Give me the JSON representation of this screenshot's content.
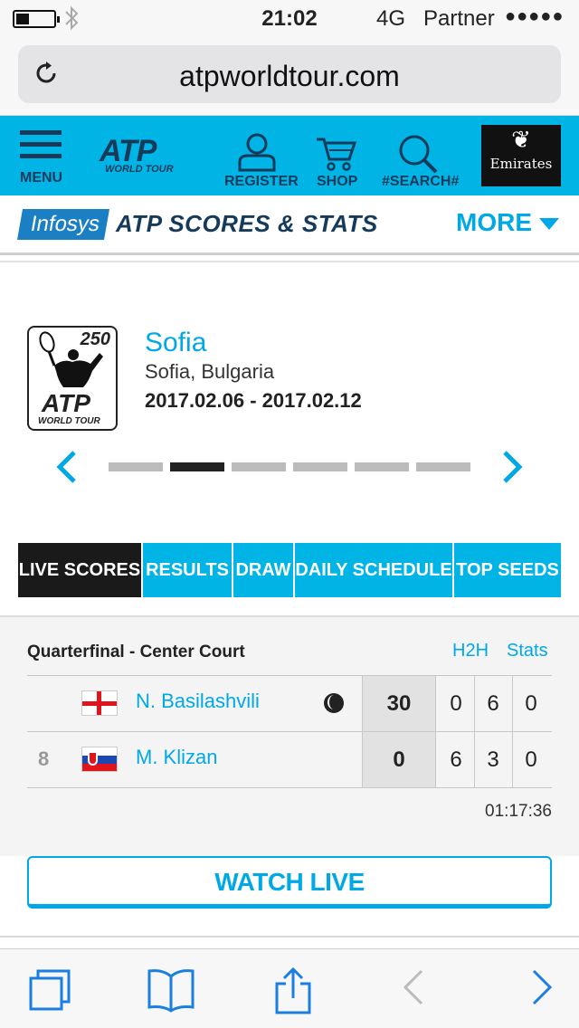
{
  "status_bar": {
    "time": "21:02",
    "network": "4G",
    "carrier": "Partner",
    "signal": "●●●●●"
  },
  "browser": {
    "url": "atpworldtour.com"
  },
  "header": {
    "menu_label": "MENU",
    "logo_main": "ATP",
    "logo_sub": "WORLD TOUR",
    "register_label": "REGISTER",
    "shop_label": "SHOP",
    "search_label": "#SEARCH#",
    "sponsor_label": "Emirates",
    "brand_color": "#00b4e6"
  },
  "scores_bar": {
    "sponsor": "Infosys",
    "title": "ATP SCORES & STATS",
    "more_label": "MORE"
  },
  "tournament": {
    "badge_number": "250",
    "badge_atp": "ATP",
    "badge_sub": "WORLD TOUR",
    "name": "Sofia",
    "location": "Sofia, Bulgaria",
    "dates": "2017.02.06 - 2017.02.12",
    "carousel_pages": 6,
    "carousel_active_index": 1
  },
  "tabs": [
    {
      "label": "LIVE SCORES",
      "active": true
    },
    {
      "label": "RESULTS",
      "active": false
    },
    {
      "label": "DRAW",
      "active": false
    },
    {
      "label": "DAILY SCHEDULE",
      "active": false
    },
    {
      "label": "TOP SEEDS",
      "active": false
    }
  ],
  "match": {
    "round": "Quarterfinal - Center Court",
    "h2h_label": "H2H",
    "stats_label": "Stats",
    "players": [
      {
        "seed": "",
        "country": "Georgia",
        "name": "N. Basilashvili",
        "serving": true,
        "points": "30",
        "sets": [
          "0",
          "6",
          "0"
        ]
      },
      {
        "seed": "8",
        "country": "Slovakia",
        "name": "M. Klizan",
        "serving": false,
        "points": "0",
        "sets": [
          "6",
          "3",
          "0"
        ]
      }
    ],
    "elapsed": "01:17:36",
    "watch_label": "WATCH LIVE"
  },
  "toolbar": {
    "icons": [
      "tabs-icon",
      "bookmarks-icon",
      "share-icon",
      "back-icon",
      "forward-icon"
    ]
  }
}
